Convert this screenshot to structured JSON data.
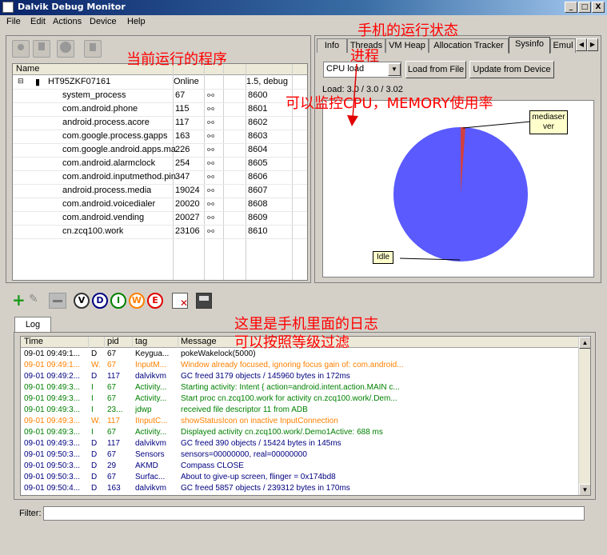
{
  "window": {
    "title": "Dalvik Debug Monitor",
    "min": "_",
    "max": "□",
    "close": "X"
  },
  "menu": [
    "File",
    "Edit",
    "Actions",
    "Device",
    "Help"
  ],
  "devices": {
    "headers": [
      "Name",
      "",
      "",
      ""
    ],
    "device": {
      "name": "HT95ZKF07161",
      "status": "Online",
      "version": "1.5, debug"
    },
    "processes": [
      {
        "name": "system_process",
        "pid": "67",
        "port": "8600"
      },
      {
        "name": "com.android.phone",
        "pid": "115",
        "port": "8601"
      },
      {
        "name": "android.process.acore",
        "pid": "117",
        "port": "8602"
      },
      {
        "name": "com.google.process.gapps",
        "pid": "163",
        "port": "8603"
      },
      {
        "name": "com.google.android.apps.ma",
        "pid": "226",
        "port": "8604"
      },
      {
        "name": "com.android.alarmclock",
        "pid": "254",
        "port": "8605"
      },
      {
        "name": "com.android.inputmethod.pin",
        "pid": "347",
        "port": "8606"
      },
      {
        "name": "android.process.media",
        "pid": "19024",
        "port": "8607"
      },
      {
        "name": "com.android.voicedialer",
        "pid": "20020",
        "port": "8608"
      },
      {
        "name": "com.android.vending",
        "pid": "20027",
        "port": "8609"
      },
      {
        "name": "cn.zcq100.work",
        "pid": "23106",
        "port": "8610"
      }
    ]
  },
  "tabs": [
    "Info",
    "Threads",
    "VM Heap",
    "Allocation Tracker",
    "Sysinfo",
    "Emul"
  ],
  "sysinfo": {
    "select": "CPU load",
    "load_file": "Load from File",
    "update": "Update from Device",
    "load_text": "Load: 3.0 / 3.0 / 3.02",
    "pie_label_a": "mediaser ver",
    "pie_label_b": "Idle",
    "pie_main_color": "#5a5aff",
    "pie_slice_color": "#d04040"
  },
  "annotations": {
    "programs": "当前运行的程序",
    "phone_state": "手机的运行状态",
    "process": "进程",
    "monitor": "可以监控CPU，MEMORY使用率",
    "log": "这里是手机里面的日志",
    "filter": "可以按照等级过滤"
  },
  "log": {
    "tab": "Log",
    "buttons": [
      "V",
      "D",
      "I",
      "W",
      "E"
    ],
    "headers": [
      "Time",
      "",
      "pid",
      "tag",
      "Message"
    ],
    "rows": [
      {
        "time": "09-01 09:49:1...",
        "lv": "D",
        "pid": "67",
        "tag": "Keygua...",
        "msg": "pokeWakelock(5000)",
        "color": "#000000"
      },
      {
        "time": "09-01 09:49:1...",
        "lv": "W.",
        "pid": "67",
        "tag": "InputM...",
        "msg": "Window already focused, ignoring focus gain of: com.android...",
        "color": "#ff8000"
      },
      {
        "time": "09-01 09:49:2...",
        "lv": "D",
        "pid": "117",
        "tag": "dalvikvm",
        "msg": "GC freed 3179 objects / 145960 bytes in 172ms",
        "color": "#000080"
      },
      {
        "time": "09-01 09:49:3...",
        "lv": "I",
        "pid": "67",
        "tag": "Activity...",
        "msg": "Starting activity: Intent { action=android.intent.action.MAIN c...",
        "color": "#008000"
      },
      {
        "time": "09-01 09:49:3...",
        "lv": "I",
        "pid": "67",
        "tag": "Activity...",
        "msg": "Start proc cn.zcq100.work for activity cn.zcq100.work/.Dem...",
        "color": "#008000"
      },
      {
        "time": "09-01 09:49:3...",
        "lv": "I",
        "pid": "23...",
        "tag": "jdwp",
        "msg": "received file descriptor 11 from ADB",
        "color": "#008000"
      },
      {
        "time": "09-01 09:49:3...",
        "lv": "W.",
        "pid": "117",
        "tag": "IInputC...",
        "msg": "showStatusIcon on inactive InputConnection",
        "color": "#ff8000"
      },
      {
        "time": "09-01 09:49:3...",
        "lv": "I",
        "pid": "67",
        "tag": "Activity...",
        "msg": "Displayed activity cn.zcq100.work/.Demo1Active: 688 ms",
        "color": "#008000"
      },
      {
        "time": "09-01 09:49:3...",
        "lv": "D",
        "pid": "117",
        "tag": "dalvikvm",
        "msg": "GC freed 390 objects / 15424 bytes in 145ms",
        "color": "#000080"
      },
      {
        "time": "09-01 09:50:3...",
        "lv": "D",
        "pid": "67",
        "tag": "Sensors",
        "msg": "sensors=00000000, real=00000000",
        "color": "#000080"
      },
      {
        "time": "09-01 09:50:3...",
        "lv": "D",
        "pid": "29",
        "tag": "AKMD",
        "msg": "Compass CLOSE",
        "color": "#000080"
      },
      {
        "time": "09-01 09:50:3...",
        "lv": "D",
        "pid": "67",
        "tag": "Surfac...",
        "msg": "About to give-up screen, flinger = 0x174bd8",
        "color": "#000080"
      },
      {
        "time": "09-01 09:50:4...",
        "lv": "D",
        "pid": "163",
        "tag": "dalvikvm",
        "msg": "GC freed 5857 objects / 239312 bytes in 170ms",
        "color": "#000080"
      }
    ],
    "filter_label": "Filter:"
  }
}
